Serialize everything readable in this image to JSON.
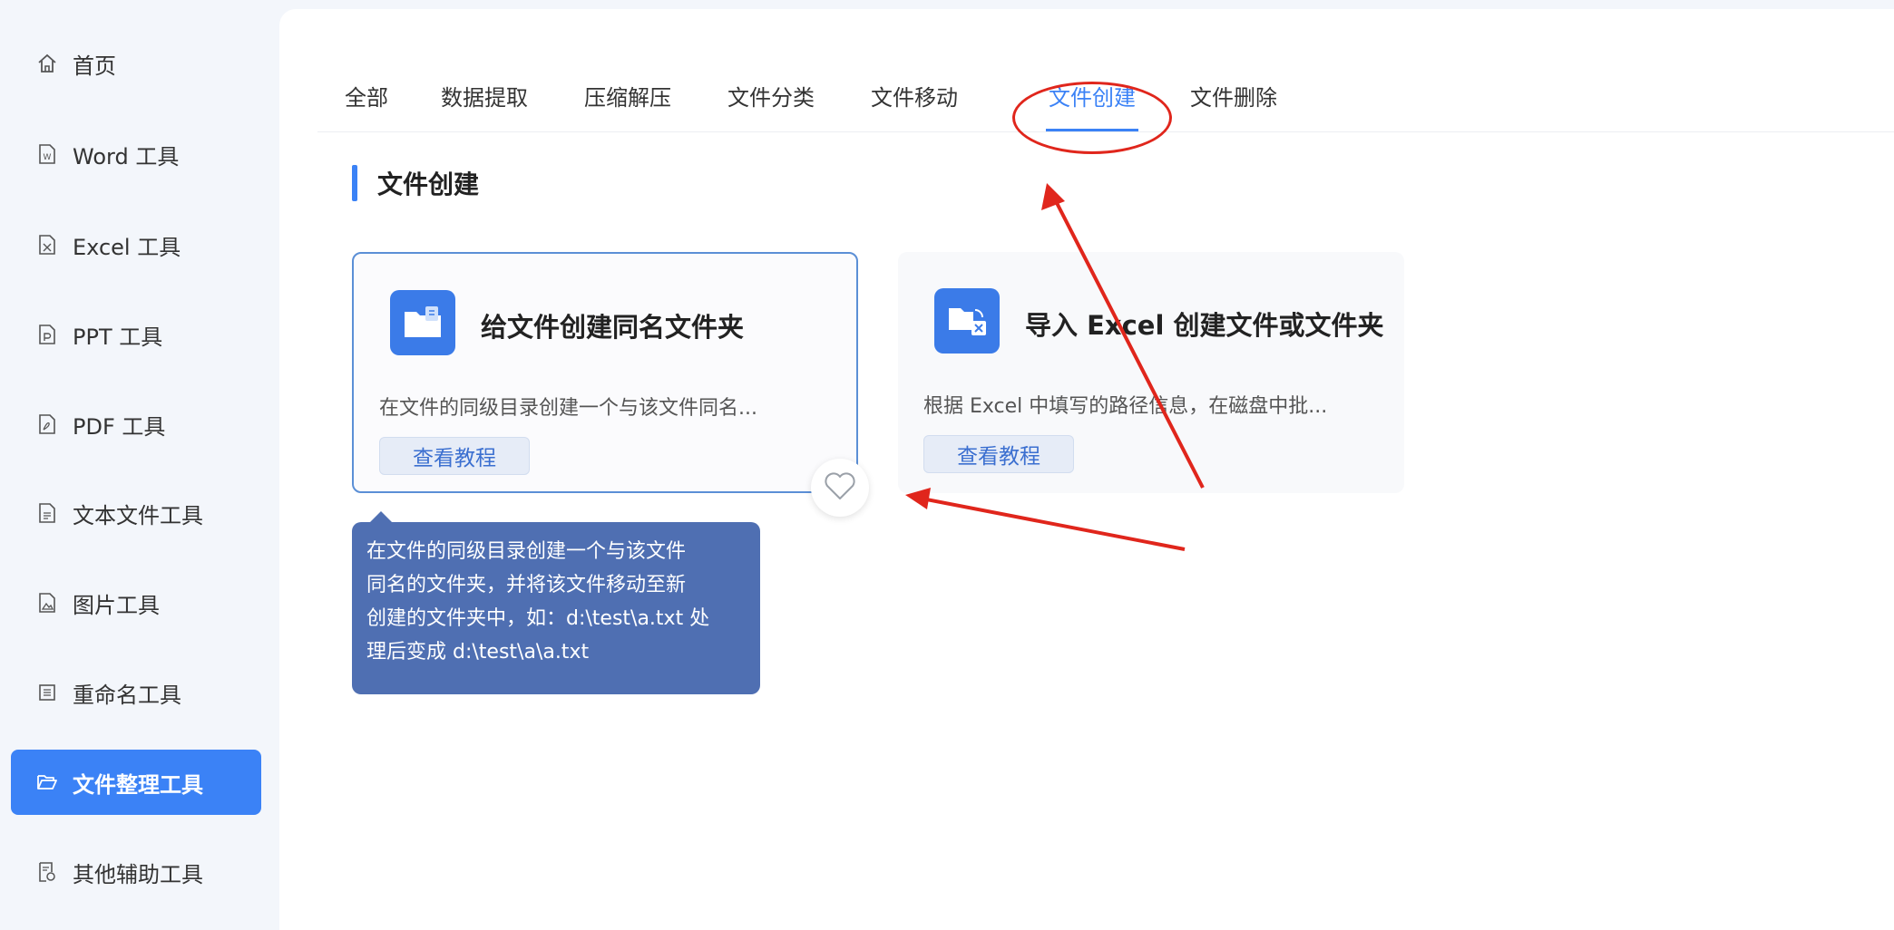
{
  "sidebar": {
    "items": [
      {
        "label": "首页",
        "icon": "home-icon",
        "active": false
      },
      {
        "label": "Word 工具",
        "icon": "word-file-icon",
        "active": false
      },
      {
        "label": "Excel 工具",
        "icon": "excel-file-icon",
        "active": false
      },
      {
        "label": "PPT 工具",
        "icon": "ppt-file-icon",
        "active": false
      },
      {
        "label": "PDF 工具",
        "icon": "pdf-file-icon",
        "active": false
      },
      {
        "label": "文本文件工具",
        "icon": "text-file-icon",
        "active": false
      },
      {
        "label": "图片工具",
        "icon": "image-file-icon",
        "active": false
      },
      {
        "label": "重命名工具",
        "icon": "rename-icon",
        "active": false
      },
      {
        "label": "文件整理工具",
        "icon": "folder-open-icon",
        "active": true
      },
      {
        "label": "其他辅助工具",
        "icon": "misc-tools-icon",
        "active": false
      }
    ]
  },
  "tabs": [
    {
      "label": "全部",
      "active": false
    },
    {
      "label": "数据提取",
      "active": false
    },
    {
      "label": "压缩解压",
      "active": false
    },
    {
      "label": "文件分类",
      "active": false
    },
    {
      "label": "文件移动",
      "active": false
    },
    {
      "label": "文件创建",
      "active": true
    },
    {
      "label": "文件删除",
      "active": false
    }
  ],
  "section": {
    "title": "文件创建"
  },
  "cards": [
    {
      "title": "给文件创建同名文件夹",
      "description": "在文件的同级目录创建一个与该文件同名...",
      "button": "查看教程",
      "icon": "folder-file-icon",
      "selected": true
    },
    {
      "title": "导入 Excel 创建文件或文件夹",
      "description": "根据 Excel 中填写的路径信息，在磁盘中批...",
      "button": "查看教程",
      "icon": "folder-excel-icon",
      "selected": false
    }
  ],
  "favorite": {
    "icon": "heart-icon"
  },
  "tooltip": {
    "lines": [
      "在文件的同级目录创建一个与该文件",
      "同名的文件夹，并将该文件移动至新",
      "创建的文件夹中，如：d:\\test\\a.txt 处",
      "理后变成 d:\\test\\a\\a.txt"
    ]
  },
  "colors": {
    "accent": "#3b82f6",
    "annotation_red": "#e0261c",
    "tooltip_bg": "#4f6fb2"
  }
}
